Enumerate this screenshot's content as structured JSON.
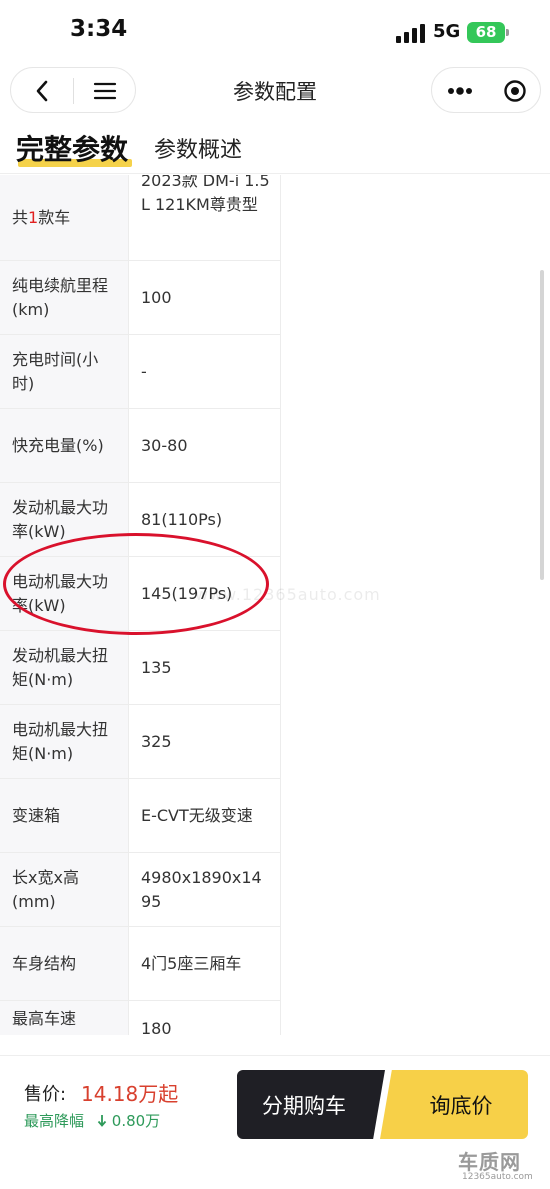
{
  "status_bar": {
    "time": "3:34",
    "network": "5G",
    "battery": "68"
  },
  "nav": {
    "title": "参数配置"
  },
  "tabs": {
    "active": "完整参数",
    "other": "参数概述"
  },
  "params": [
    {
      "label": "共1款车",
      "value": "2023款 DM-i 1.5L 121KM尊贵型"
    },
    {
      "label": "纯电续航里程(km)",
      "value": "100"
    },
    {
      "label": "充电时间(小时)",
      "value": "-"
    },
    {
      "label": "快充电量(%)",
      "value": "30-80"
    },
    {
      "label": "发动机最大功率(kW)",
      "value": "81(110Ps)"
    },
    {
      "label": "电动机最大功率(kW)",
      "value": "145(197Ps)"
    },
    {
      "label": "发动机最大扭矩(N·m)",
      "value": "135"
    },
    {
      "label": "电动机最大扭矩(N·m)",
      "value": "325"
    },
    {
      "label": "变速箱",
      "value": "E-CVT无级变速"
    },
    {
      "label": "长x宽x高(mm)",
      "value": "4980x1890x1495"
    },
    {
      "label": "车身结构",
      "value": "4门5座三厢车"
    },
    {
      "label": "最高车速(km/h)",
      "value": "180"
    }
  ],
  "watermark": "www.12365auto.com",
  "bottom": {
    "price_label": "售价:",
    "price_value": "14.18万起",
    "drop_label": "最高降幅",
    "drop_value": "0.80万",
    "installment_button": "分期购车",
    "inquiry_button": "询底价"
  },
  "logo": {
    "name": "车质网",
    "url": "12365auto.com"
  },
  "colors": {
    "accent_yellow": "#f7d048",
    "price_red": "#d8402e",
    "drop_green": "#2e9a5a",
    "annotation_red": "#d9112c"
  }
}
